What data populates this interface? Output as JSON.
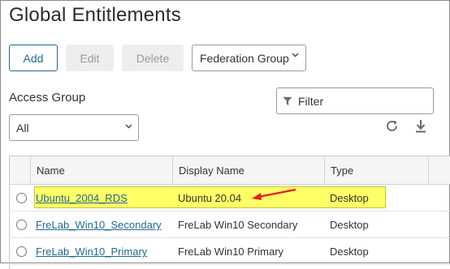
{
  "page": {
    "title": "Global Entitlements"
  },
  "toolbar": {
    "add_label": "Add",
    "edit_label": "Edit",
    "delete_label": "Delete",
    "federation_label": "Federation Group"
  },
  "access_group": {
    "label": "Access Group",
    "selected": "All"
  },
  "filter": {
    "placeholder": "Filter"
  },
  "icons": {
    "refresh": "refresh-icon",
    "download": "download-icon",
    "filter": "filter-icon",
    "chevron": "chevron-down-icon"
  },
  "table": {
    "columns": [
      "Name",
      "Display Name",
      "Type"
    ],
    "rows": [
      {
        "name": "Ubuntu_2004_RDS",
        "display_name": "Ubuntu 20.04",
        "type": "Desktop"
      },
      {
        "name": "FreLab_Win10_Secondary",
        "display_name": "FreLab Win10 Secondary",
        "type": "Desktop"
      },
      {
        "name": "FreLab_Win10_Primary",
        "display_name": "FreLab Win10 Primary",
        "type": "Desktop"
      }
    ]
  },
  "colors": {
    "accent": "#1f6a93",
    "highlight": "#ffff66",
    "arrow": "#e02020"
  }
}
